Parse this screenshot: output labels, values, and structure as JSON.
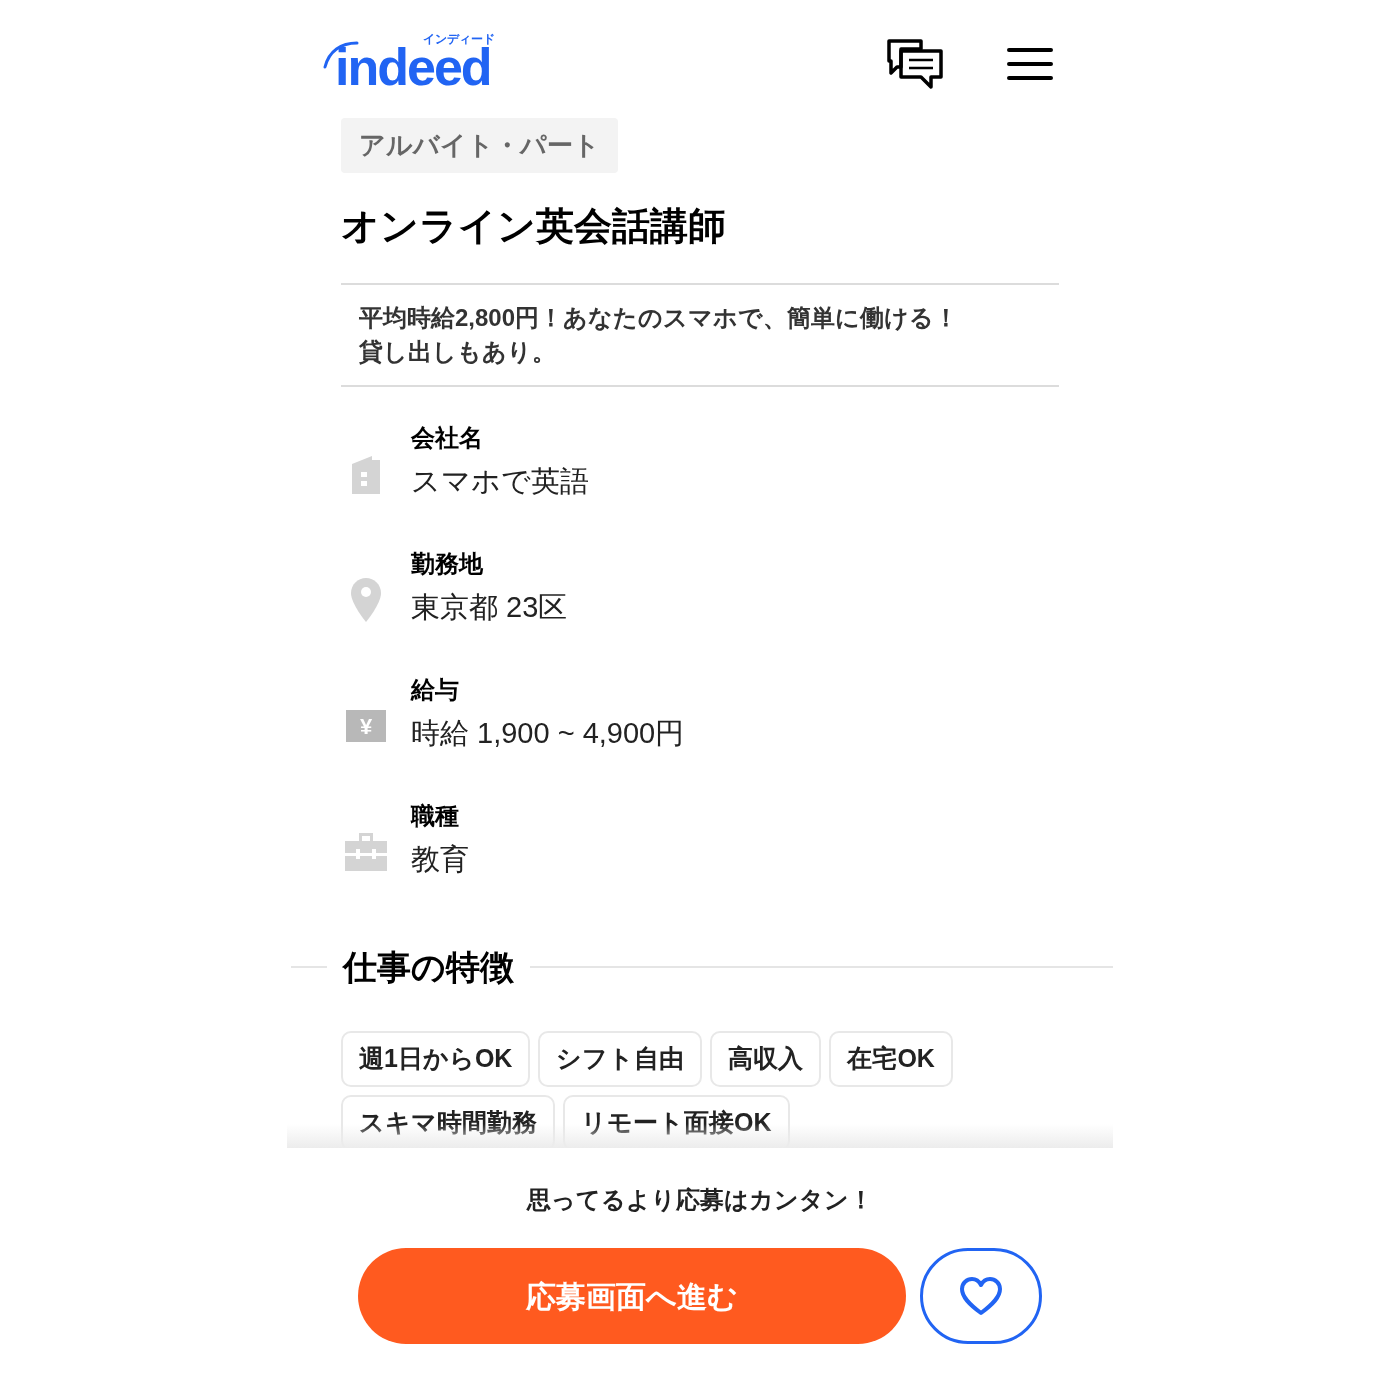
{
  "header": {
    "logo": "indeed",
    "logo_kana": "インディード"
  },
  "job": {
    "employment_type": "アルバイト・パート",
    "title": "オンライン英会話講師",
    "catchphrase_lines": [
      "平均時給2,800円！あなたのスマホで、簡単に働ける！",
      "貸し出しもあり。"
    ]
  },
  "details": [
    {
      "kind": "building",
      "label": "会社名",
      "value": "スマホで英語"
    },
    {
      "kind": "pin",
      "label": "勤務地",
      "value": "東京都 23区"
    },
    {
      "kind": "yen",
      "icon_text": "¥",
      "label": "給与",
      "value": "時給 1,900 ~ 4,900円"
    },
    {
      "kind": "briefcase",
      "label": "職種",
      "value": "教育"
    }
  ],
  "features": {
    "heading": "仕事の特徴",
    "tags": [
      "週1日からOK",
      "シフト自由",
      "高収入",
      "在宅OK",
      "スキマ時間勤務",
      "リモート面接OK"
    ]
  },
  "footer": {
    "message": "思ってるより応募はカンタン！",
    "apply_button": "応募画面へ進む"
  }
}
